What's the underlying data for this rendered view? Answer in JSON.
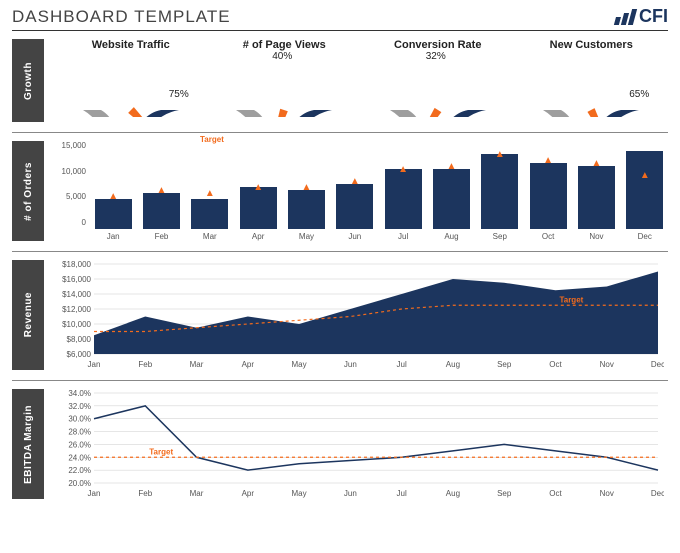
{
  "header": {
    "title": "DASHBOARD TEMPLATE",
    "logo_text": "CFI"
  },
  "sections": {
    "growth": "Growth",
    "orders": "# of Orders",
    "revenue": "Revenue",
    "ebitda": "EBITDA Margin"
  },
  "gauges": [
    {
      "title": "Website Traffic",
      "value_pct": 75,
      "label": "75%"
    },
    {
      "title": "# of Page Views",
      "value_pct": 40,
      "label": "40%"
    },
    {
      "title": "Conversion Rate",
      "value_pct": 32,
      "label": "32%"
    },
    {
      "title": "New Customers",
      "value_pct": 65,
      "label": "65%"
    }
  ],
  "legend": {
    "target": "Target"
  },
  "months": [
    "Jan",
    "Feb",
    "Mar",
    "Apr",
    "May",
    "Jun",
    "Jul",
    "Aug",
    "Sep",
    "Oct",
    "Nov",
    "Dec"
  ],
  "orders_yticks": [
    "15,000",
    "10,000",
    "5,000",
    "0"
  ],
  "revenue_yticks": [
    "$18,000",
    "$16,000",
    "$14,000",
    "$12,000",
    "$10,000",
    "$8,000",
    "$6,000"
  ],
  "ebitda_yticks": [
    "34.0%",
    "32.0%",
    "30.0%",
    "28.0%",
    "26.0%",
    "24.0%",
    "22.0%",
    "20.0%"
  ],
  "chart_data": [
    {
      "type": "bar",
      "title": "# of Orders",
      "categories": [
        "Jan",
        "Feb",
        "Mar",
        "Apr",
        "May",
        "Jun",
        "Jul",
        "Aug",
        "Sep",
        "Oct",
        "Nov",
        "Dec"
      ],
      "series": [
        {
          "name": "Orders",
          "values": [
            5000,
            6000,
            5000,
            7000,
            6500,
            7500,
            10000,
            10000,
            12500,
            11000,
            10500,
            13000
          ]
        },
        {
          "name": "Target",
          "values": [
            4500,
            5500,
            5000,
            6000,
            6000,
            7000,
            9000,
            9500,
            11500,
            10500,
            10000,
            8000
          ]
        }
      ],
      "ylim": [
        0,
        15000
      ],
      "ylabel": ""
    },
    {
      "type": "area",
      "title": "Revenue",
      "categories": [
        "Jan",
        "Feb",
        "Mar",
        "Apr",
        "May",
        "Jun",
        "Jul",
        "Aug",
        "Sep",
        "Oct",
        "Nov",
        "Dec"
      ],
      "series": [
        {
          "name": "Revenue",
          "values": [
            8500,
            11000,
            9500,
            11000,
            10000,
            12000,
            14000,
            16000,
            15500,
            14500,
            15000,
            17000
          ]
        },
        {
          "name": "Target",
          "values": [
            9000,
            9000,
            9500,
            10000,
            10500,
            11000,
            12000,
            12500,
            12500,
            12500,
            12500,
            12500
          ]
        }
      ],
      "ylim": [
        6000,
        18000
      ],
      "ylabel": ""
    },
    {
      "type": "line",
      "title": "EBITDA Margin",
      "categories": [
        "Jan",
        "Feb",
        "Mar",
        "Apr",
        "May",
        "Jun",
        "Jul",
        "Aug",
        "Sep",
        "Oct",
        "Nov",
        "Dec"
      ],
      "series": [
        {
          "name": "EBITDA Margin",
          "values": [
            30.0,
            32.0,
            24.0,
            22.0,
            23.0,
            23.5,
            24.0,
            25.0,
            26.0,
            25.0,
            24.0,
            22.0
          ]
        },
        {
          "name": "Target",
          "values": [
            24.0,
            24.0,
            24.0,
            24.0,
            24.0,
            24.0,
            24.0,
            24.0,
            24.0,
            24.0,
            24.0,
            24.0
          ]
        }
      ],
      "ylim": [
        20.0,
        34.0
      ],
      "ylabel": ""
    }
  ]
}
